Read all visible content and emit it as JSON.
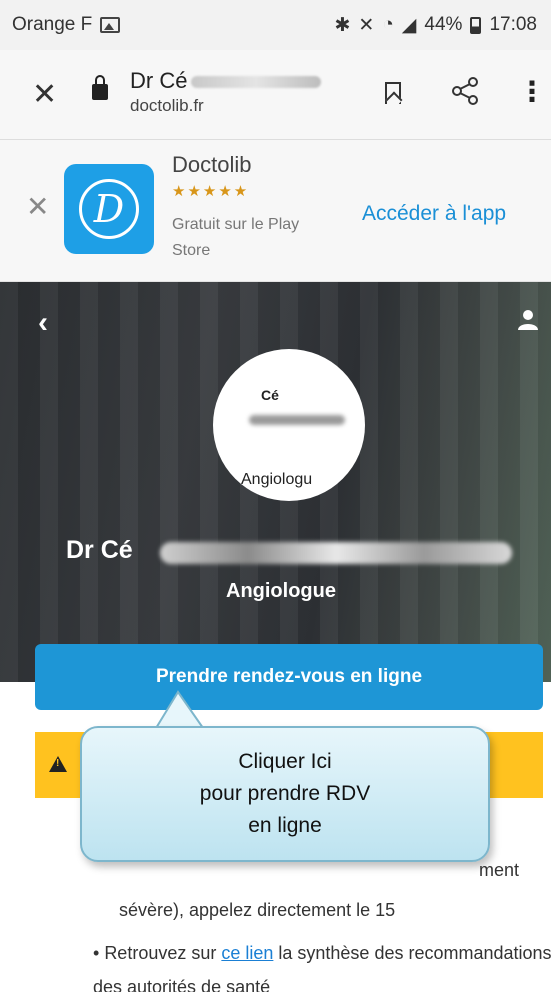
{
  "status_bar": {
    "carrier": "Orange F",
    "battery": "44%",
    "time": "17:08"
  },
  "browser": {
    "page_title": "Dr Cé",
    "domain": "doctolib.fr"
  },
  "app_banner": {
    "app_name": "Doctolib",
    "stars": "★★★★★",
    "subtitle": "Gratuit sur le Play Store",
    "cta": "Accéder à l'app"
  },
  "hero": {
    "avatar_top": "Cé",
    "avatar_bottom": "Angiologu",
    "doctor_name": "Dr Cé",
    "specialty": "Angiologue"
  },
  "main": {
    "book_button": "Prendre rendez-vous en ligne",
    "warning_tail": "ment",
    "warning_line": "sévère), appelez directement le 15",
    "bullet_prefix": "Retrouvez sur ",
    "bullet_link": "ce lien",
    "bullet_suffix": " la synthèse des recommandations des autorités de santé"
  },
  "callout": {
    "line1": "Cliquer Ici",
    "line2": "pour prendre RDV",
    "line3": "en ligne"
  }
}
